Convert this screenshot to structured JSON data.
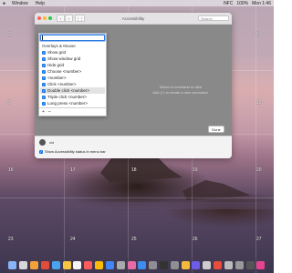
{
  "menubar": {
    "apple": "",
    "items": [
      "Window",
      "Help"
    ],
    "status_right": [
      "NFC",
      "100%",
      "Mon 1:46"
    ]
  },
  "grid": {
    "numbers": [
      "1",
      "2",
      "3",
      "4",
      "5",
      "6",
      "7",
      "8",
      "9",
      "10",
      "11",
      "12",
      "13",
      "14",
      "15",
      "16",
      "17",
      "18",
      "19",
      "20",
      "21",
      "22",
      "23",
      "24",
      "25",
      "26",
      "27",
      "28",
      "29",
      "30"
    ]
  },
  "window": {
    "title": "Accessibility",
    "search_placeholder": "Search",
    "command_hint_line1": "Select a command or click",
    "command_hint_line2": "Add (+) to create a new command.",
    "done_label": "Done",
    "user_name": "sid",
    "status_checkbox_label": "Show Accessibility status in menu bar",
    "status_checkbox_checked": true
  },
  "dropdown": {
    "search_value": "",
    "header": "Overlays & Mouse",
    "items": [
      {
        "label": "Show grid",
        "checked": true
      },
      {
        "label": "Show window grid",
        "checked": true
      },
      {
        "label": "Hide grid",
        "checked": true
      },
      {
        "label": "Choose <number>",
        "checked": true
      },
      {
        "label": "<number>",
        "checked": true
      },
      {
        "label": "Click <number>",
        "checked": true
      },
      {
        "label": "Double click <number>",
        "checked": true
      },
      {
        "label": "Triple click <number>",
        "checked": true
      },
      {
        "label": "Long press <number>",
        "checked": true
      }
    ],
    "add_label": "+",
    "remove_label": "–"
  },
  "dock": {
    "colors": [
      "#8ab4f8",
      "#d8d8d8",
      "#f2a23a",
      "#e24c3a",
      "#4aa3f0",
      "#f5c542",
      "#f4f4f4",
      "#ff5c5c",
      "#fbbc05",
      "#4285f4",
      "#aaaaaa",
      "#e86aa6",
      "#3d8cf0",
      "#8e8e93",
      "#333333",
      "#8e8e93",
      "#f6b93b",
      "#6c5ce7",
      "#cccccc",
      "#e74c3c",
      "#bbbbbb",
      "#999999",
      "#555555",
      "#e84393"
    ]
  },
  "colors": {
    "accent": "#1677e8",
    "close": "#ff5f57",
    "minimize": "#febc2e",
    "zoom": "#28c840"
  }
}
